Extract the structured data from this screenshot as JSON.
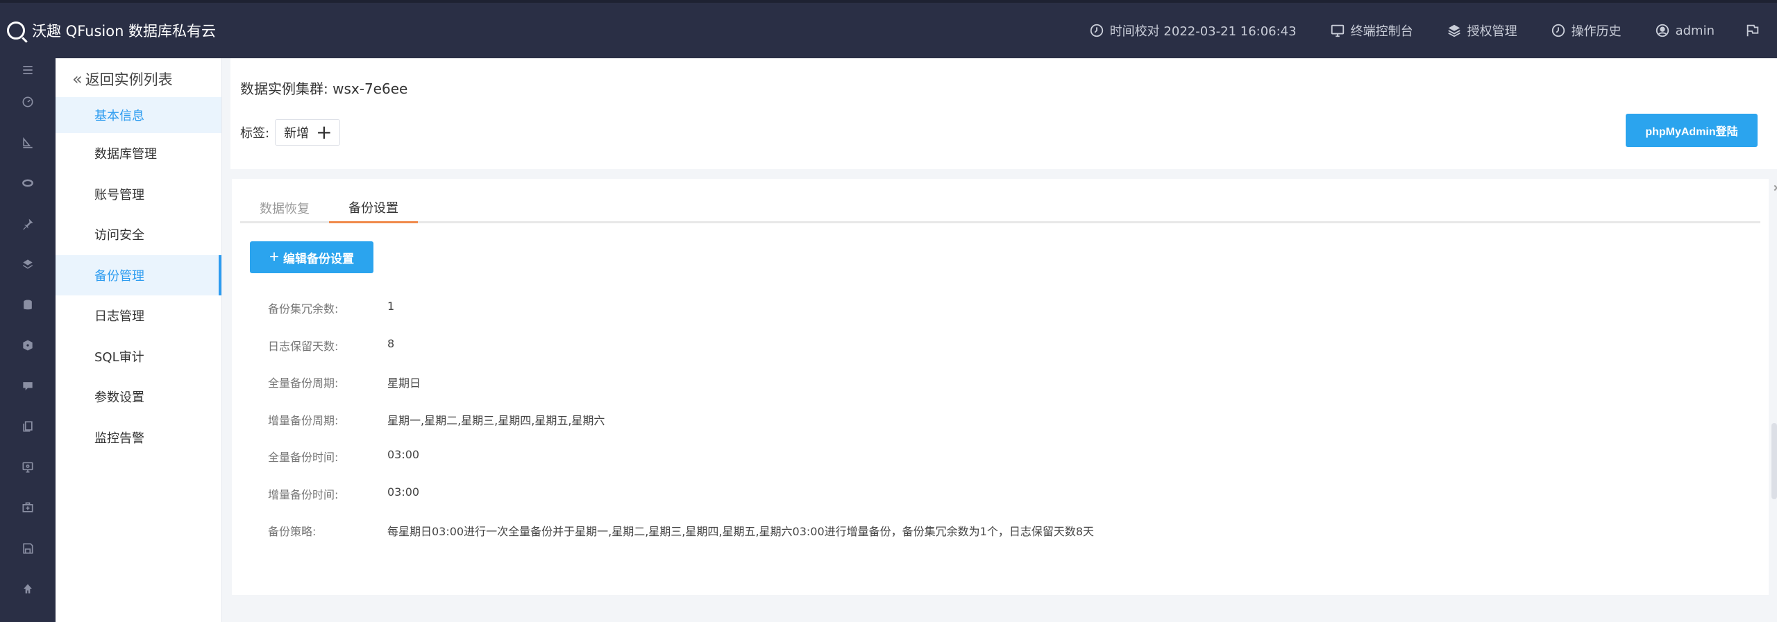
{
  "app": {
    "title": "沃趣 QFusion 数据库私有云"
  },
  "topbar": {
    "time_sync": "时间校对 2022-03-21 16:06:43",
    "console": "终端控制台",
    "license": "授权管理",
    "history": "操作历史",
    "user": "admin"
  },
  "rail": {
    "icons": [
      "menu-toggle-icon",
      "dashboard-icon",
      "monitor-icon",
      "cluster-icon",
      "pin-icon",
      "layers-icon",
      "database-icon",
      "package-icon",
      "chat-icon",
      "copy-icon",
      "screen-icon",
      "medkit-icon",
      "save-icon",
      "user-icon"
    ]
  },
  "submenu": {
    "back_label": "返回实例列表",
    "items": [
      "基本信息",
      "数据库管理",
      "账号管理",
      "访问安全",
      "备份管理",
      "日志管理",
      "SQL审计",
      "参数设置",
      "监控告警"
    ],
    "active_index": 4
  },
  "header": {
    "cluster_label": "数据实例集群:",
    "cluster_name": "wsx-7e6ee",
    "tag_label": "标签:",
    "tag_add_label": "新增",
    "phpmyadmin_button": "phpMyAdmin登陆"
  },
  "tabs": {
    "items": [
      "数据恢复",
      "备份设置"
    ],
    "active_index": 1
  },
  "backup": {
    "edit_button": "编辑备份设置",
    "fields": [
      {
        "label": "备份集冗余数:",
        "value": "1"
      },
      {
        "label": "日志保留天数:",
        "value": "8"
      },
      {
        "label": "全量备份周期:",
        "value": "星期日"
      },
      {
        "label": "增量备份周期:",
        "value": "星期一,星期二,星期三,星期四,星期五,星期六"
      },
      {
        "label": "全量备份时间:",
        "value": "03:00"
      },
      {
        "label": "增量备份时间:",
        "value": "03:00"
      },
      {
        "label": "备份策略:",
        "value": "每星期日03:00进行一次全量备份并于星期一,星期二,星期三,星期四,星期五,星期六03:00进行增量备份，备份集冗余数为1个，日志保留天数8天"
      }
    ]
  },
  "colors": {
    "topbar_bg": "#2a2f45",
    "accent_blue": "#2ba4ee",
    "active_tab_underline": "#f08a4b"
  }
}
